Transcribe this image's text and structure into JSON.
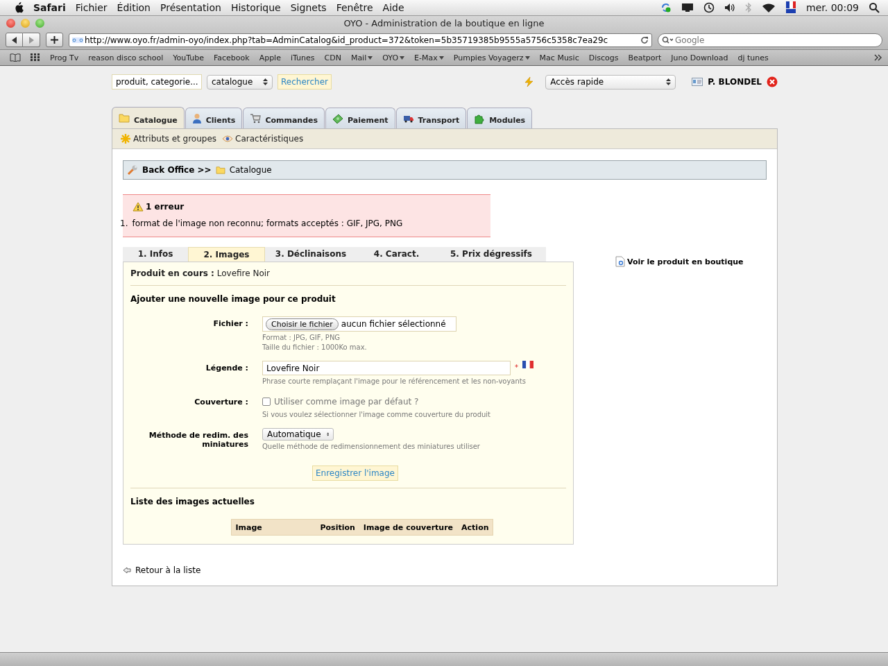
{
  "menubar": {
    "app": "Safari",
    "menus": [
      "Fichier",
      "Édition",
      "Présentation",
      "Historique",
      "Signets",
      "Fenêtre",
      "Aide"
    ],
    "clock": "mer. 00:09"
  },
  "window": {
    "title": "OYO - Administration de la boutique en ligne"
  },
  "toolbar": {
    "url": "http://www.oyo.fr/admin-oyo/index.php?tab=AdminCatalog&id_product=372&token=5b35719385b9555a5756c5358c7ea29c",
    "search_placeholder": "Google"
  },
  "bookmarks": [
    {
      "label": "Prog Tv",
      "menu": false
    },
    {
      "label": "reason disco school",
      "menu": false
    },
    {
      "label": "YouTube",
      "menu": false
    },
    {
      "label": "Facebook",
      "menu": false
    },
    {
      "label": "Apple",
      "menu": false
    },
    {
      "label": "iTunes",
      "menu": false
    },
    {
      "label": "CDN",
      "menu": false
    },
    {
      "label": "Mail",
      "menu": true
    },
    {
      "label": "OYO",
      "menu": true
    },
    {
      "label": "E-Max",
      "menu": true
    },
    {
      "label": "Pumpies Voyagerz",
      "menu": true
    },
    {
      "label": "Mac Music",
      "menu": false
    },
    {
      "label": "Discogs",
      "menu": false
    },
    {
      "label": "Beatport",
      "menu": false
    },
    {
      "label": "Juno Download",
      "menu": false
    },
    {
      "label": "dj tunes",
      "menu": false
    }
  ],
  "search": {
    "value": "produit, categorie...",
    "scope": "catalogue",
    "button": "Rechercher"
  },
  "quick_access": "Accès rapide",
  "user": "P. BLONDEL",
  "tabs": [
    {
      "label": "Catalogue",
      "kind": "folder",
      "selected": true
    },
    {
      "label": "Clients",
      "kind": "person",
      "selected": false
    },
    {
      "label": "Commandes",
      "kind": "cart",
      "selected": false
    },
    {
      "label": "Paiement",
      "kind": "money",
      "selected": false
    },
    {
      "label": "Transport",
      "kind": "truck",
      "selected": false
    },
    {
      "label": "Modules",
      "kind": "puzzle",
      "selected": false
    }
  ],
  "subtabs": [
    {
      "label": "Attributs et groupes",
      "kind": "star"
    },
    {
      "label": "Caractéristiques",
      "kind": "eye"
    }
  ],
  "breadcrumb": {
    "root": "Back Office >>",
    "current": "Catalogue"
  },
  "error": {
    "title": "1 erreur",
    "items": [
      {
        "number": "1.",
        "text": "format de l'image non reconnu; formats acceptés : GIF, JPG, PNG"
      }
    ]
  },
  "product_tabs": [
    {
      "label": "1. Infos",
      "selected": false
    },
    {
      "label": "2. Images",
      "selected": true
    },
    {
      "label": "3. Déclinaisons",
      "selected": false
    },
    {
      "label": "4. Caract.",
      "selected": false
    },
    {
      "label": "5. Prix dégressifs",
      "selected": false
    }
  ],
  "view_link": "Voir le produit en boutique",
  "product": {
    "label": "Produit en cours :",
    "name": "Lovefire Noir"
  },
  "form": {
    "title": "Ajouter une nouvelle image pour ce produit",
    "fields": [
      {
        "kind": "file",
        "label": "Fichier :",
        "button": "Choisir le fichier",
        "value": "aucun fichier sélectionné",
        "hints": [
          "Format : JPG, GIF, PNG",
          "Taille du fichier : 1000Ko max."
        ]
      },
      {
        "kind": "text",
        "label": "Légende :",
        "value": "Lovefire Noir",
        "required_mark": "*",
        "hints": [
          "Phrase courte remplaçant l'image pour le référencement et les non-voyants"
        ]
      },
      {
        "kind": "checkbox",
        "label": "Couverture :",
        "text": "Utiliser comme image par défaut ?",
        "checked": false,
        "hints": [
          "Si vous voulez sélectionner l'image comme couverture du produit"
        ]
      },
      {
        "kind": "select",
        "label": "Méthode de redim. des miniatures",
        "value": "Automatique",
        "hints": [
          "Quelle méthode de redimensionnement des miniatures utiliser"
        ]
      }
    ],
    "submit": "Enregistrer l'image"
  },
  "images": {
    "title": "Liste des images actuelles",
    "columns": [
      "Image",
      "Position",
      "Image de couverture",
      "Action"
    ]
  },
  "back_link": "Retour à la liste"
}
